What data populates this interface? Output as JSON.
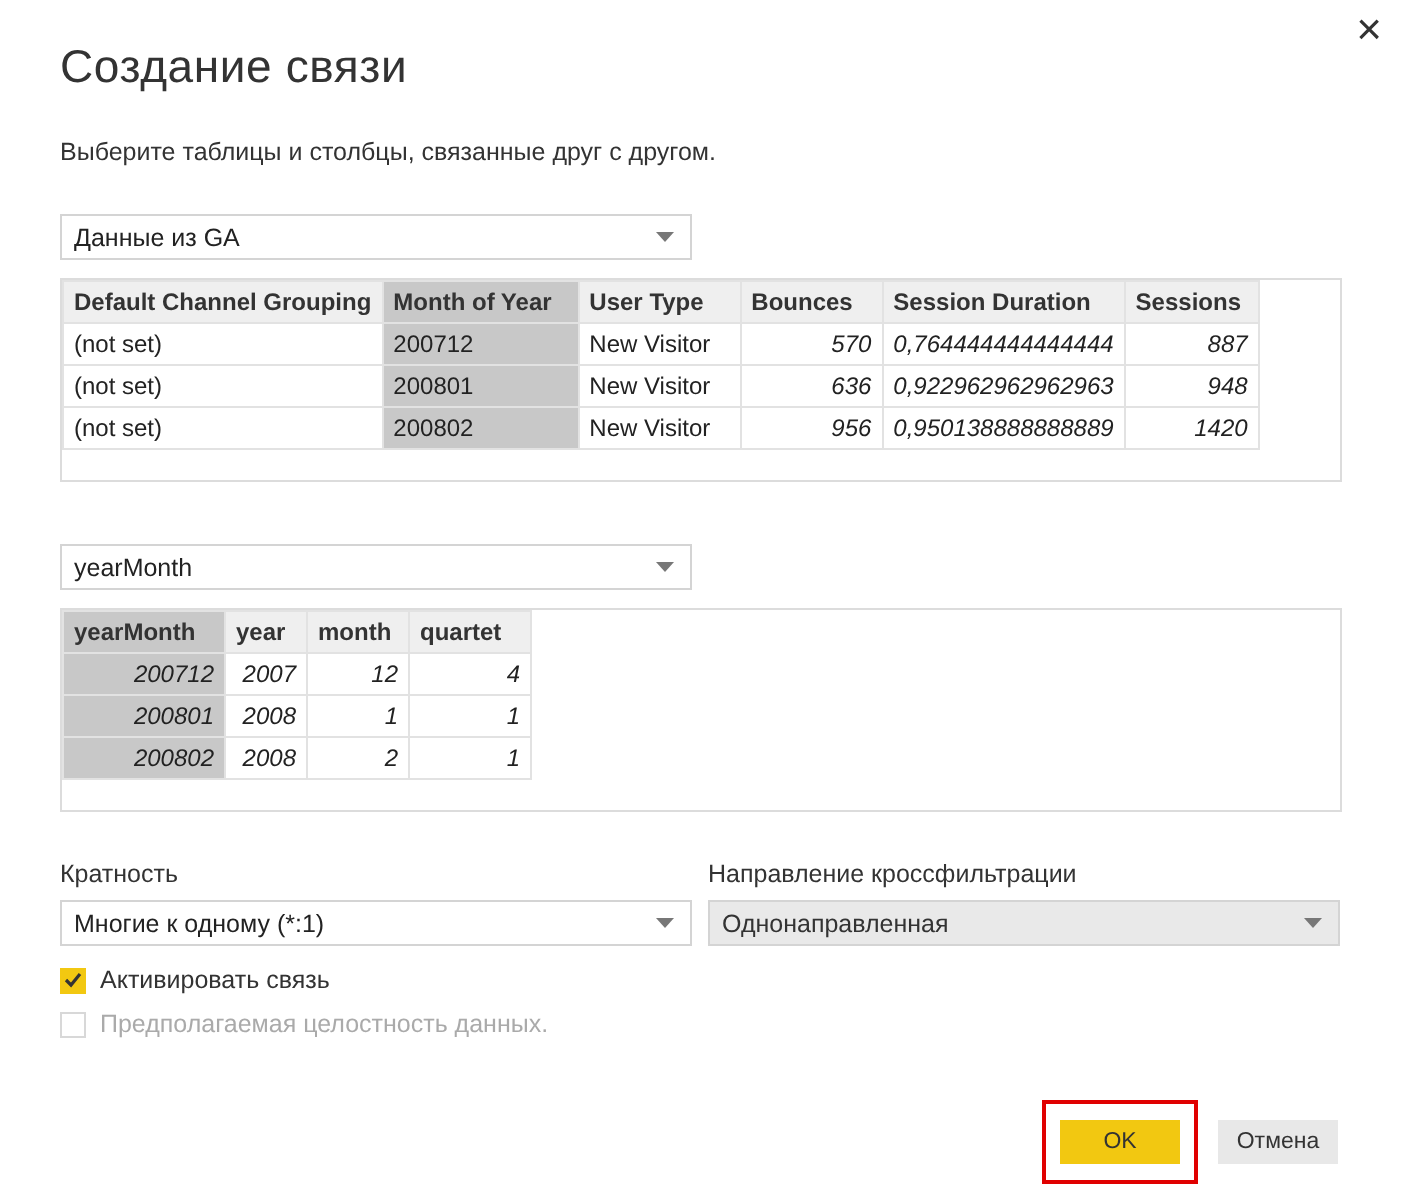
{
  "dialog": {
    "close": "×",
    "title": "Создание связи",
    "subtitle": "Выберите таблицы и столбцы, связанные друг с другом."
  },
  "tables": [
    {
      "dropdown": "Данные из GA",
      "columns": [
        {
          "label": "Default Channel Grouping",
          "selected": false,
          "kind": "text"
        },
        {
          "label": "Month of Year",
          "selected": true,
          "kind": "text"
        },
        {
          "label": "User Type",
          "selected": false,
          "kind": "text"
        },
        {
          "label": "Bounces",
          "selected": false,
          "kind": "number"
        },
        {
          "label": "Session Duration",
          "selected": false,
          "kind": "number"
        },
        {
          "label": "Sessions",
          "selected": false,
          "kind": "number"
        }
      ],
      "rows": [
        [
          "(not set)",
          "200712",
          "New Visitor",
          "570",
          "0,764444444444444",
          "887"
        ],
        [
          "(not set)",
          "200801",
          "New Visitor",
          "636",
          "0,922962962962963",
          "948"
        ],
        [
          "(not set)",
          "200802",
          "New Visitor",
          "956",
          "0,950138888888889",
          "1420"
        ]
      ]
    },
    {
      "dropdown": "yearMonth",
      "columns": [
        {
          "label": "yearMonth",
          "selected": true,
          "kind": "number"
        },
        {
          "label": "year",
          "selected": false,
          "kind": "number"
        },
        {
          "label": "month",
          "selected": false,
          "kind": "number"
        },
        {
          "label": "quartet",
          "selected": false,
          "kind": "number"
        }
      ],
      "rows": [
        [
          "200712",
          "2007",
          "12",
          "4"
        ],
        [
          "200801",
          "2008",
          "1",
          "1"
        ],
        [
          "200802",
          "2008",
          "2",
          "1"
        ]
      ]
    }
  ],
  "options": [
    {
      "label": "Кратность",
      "value": "Многие к одному (*:1)",
      "disabled": false
    },
    {
      "label": "Направление кроссфильтрации",
      "value": "Однонаправленная",
      "disabled": true
    }
  ],
  "checkboxes": [
    {
      "label": "Активировать связь",
      "checked": true,
      "disabled": false
    },
    {
      "label": "Предполагаемая целостность данных.",
      "checked": false,
      "disabled": true
    }
  ],
  "buttons": [
    {
      "label": "OK",
      "kind": "primary",
      "highlighted": true
    },
    {
      "label": "Отмена",
      "kind": "secondary",
      "highlighted": false
    }
  ]
}
